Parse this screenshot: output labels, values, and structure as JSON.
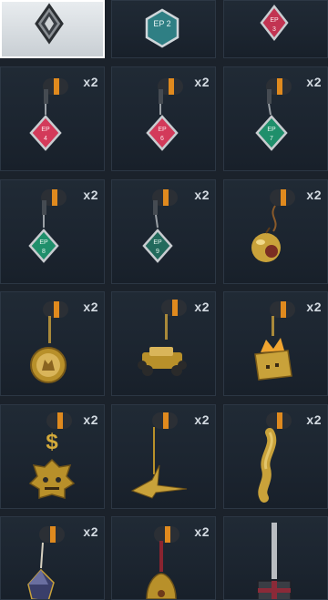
{
  "inventory": {
    "rows": [
      [
        {
          "name": "diamond-charm",
          "count": "",
          "selected": true,
          "label": ""
        },
        {
          "name": "ep2-hex-charm",
          "count": "",
          "label": "EP 2"
        },
        {
          "name": "ep3-charm",
          "count": "",
          "label": "EP 3"
        }
      ],
      [
        {
          "name": "ep4-charm",
          "count": "x2",
          "label": "EP 4"
        },
        {
          "name": "ep6-charm",
          "count": "x2",
          "label": "EP 6"
        },
        {
          "name": "ep7-charm",
          "count": "x2",
          "label": "EP 7"
        }
      ],
      [
        {
          "name": "ep8-charm",
          "count": "x2",
          "label": "EP 8"
        },
        {
          "name": "ep9-charm",
          "count": "x2",
          "label": "EP 9"
        },
        {
          "name": "golden-apple-charm",
          "count": "x2",
          "label": ""
        }
      ],
      [
        {
          "name": "coin-medallion-charm",
          "count": "x2",
          "label": ""
        },
        {
          "name": "golden-car-charm",
          "count": "x2",
          "label": ""
        },
        {
          "name": "treasure-box-charm",
          "count": "x2",
          "label": ""
        }
      ],
      [
        {
          "name": "dollar-mask-charm",
          "count": "x2",
          "label": ""
        },
        {
          "name": "paper-crane-charm",
          "count": "x2",
          "label": ""
        },
        {
          "name": "golden-figure-charm",
          "count": "x2",
          "label": ""
        }
      ],
      [
        {
          "name": "crystal-charm",
          "count": "x2",
          "label": ""
        },
        {
          "name": "bell-charm",
          "count": "x2",
          "label": ""
        },
        {
          "name": "gift-box-charm",
          "count": "",
          "label": ""
        }
      ]
    ]
  },
  "colors": {
    "cell_bg": "#1c2530",
    "pink_gem": "#d33a5a",
    "green_gem": "#1f8f6b",
    "teal_gem": "#2f7f84",
    "gold": "#c9a23a",
    "orange_band": "#e08a1e"
  }
}
